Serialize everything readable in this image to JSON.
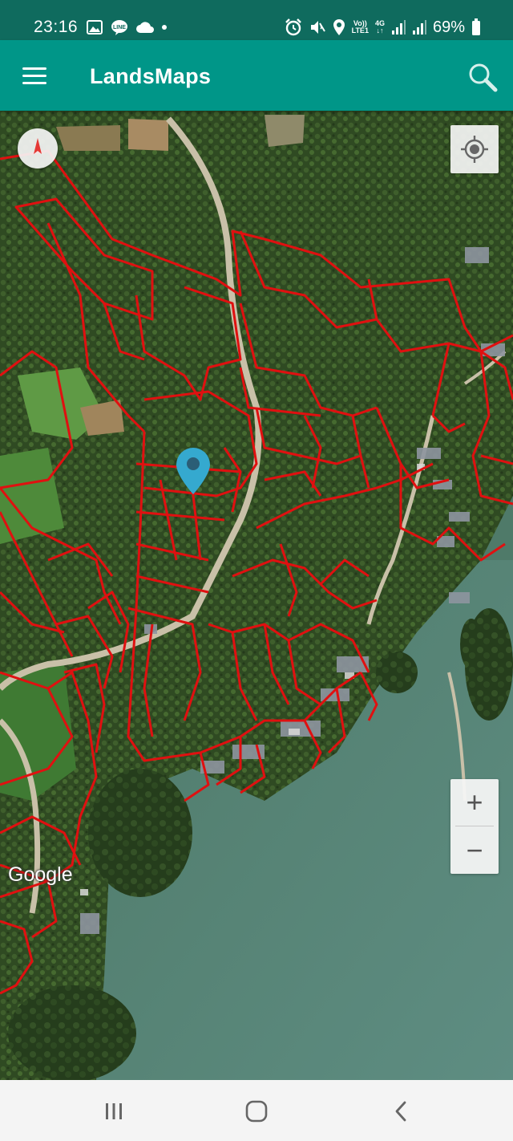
{
  "status_bar": {
    "time": "23:16",
    "network_top": "Vo))",
    "network_bottom": "LTE1",
    "signal_gen": "4G",
    "battery_percent": "69%"
  },
  "app_bar": {
    "title": "LandsMaps",
    "menu_icon": "hamburger-menu-icon",
    "search_icon": "search-icon"
  },
  "map": {
    "attribution": "Google",
    "zoom_in_label": "+",
    "zoom_out_label": "−",
    "compass_icon": "compass-icon",
    "my_location_icon": "my-location-icon",
    "marker_icon": "location-pin-icon",
    "marker_color": "#35a9cf",
    "parcel_line_color": "#e01010"
  },
  "nav_bar": {
    "recents_icon": "recent-apps-icon",
    "home_icon": "home-icon",
    "back_icon": "back-icon"
  },
  "colors": {
    "status_bar": "#0f6b5e",
    "app_bar": "#009688"
  }
}
